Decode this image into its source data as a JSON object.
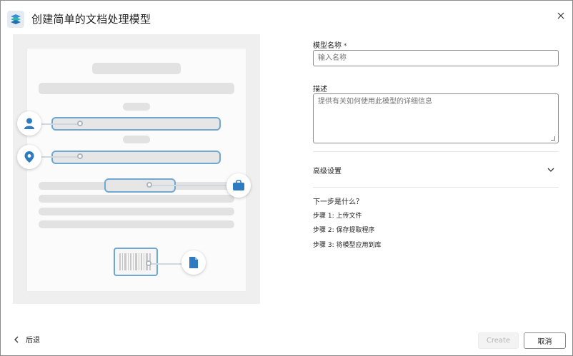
{
  "dialog": {
    "title": "创建简单的文档处理模型",
    "close_icon": "close-icon",
    "app_icon": "stack-layers-icon"
  },
  "form": {
    "name_label": "模型名称",
    "name_required_marker": "*",
    "name_placeholder": "输入名称",
    "description_label": "描述",
    "description_placeholder": "提供有关如何使用此模型的详细信息",
    "advanced_settings": "高级设置"
  },
  "next_steps": {
    "heading": "下一步是什么？",
    "steps": [
      "步骤 1: 上传文件",
      "步骤 2: 保存提取程序",
      "步骤 3: 将模型应用到库"
    ]
  },
  "footer": {
    "back_label": "后退",
    "create_label": "Create",
    "cancel_label": "取消"
  },
  "illustration_icons": [
    "person-icon",
    "location-pin-icon",
    "briefcase-icon",
    "barcode-icon",
    "document-icon"
  ],
  "colors": {
    "accent": "#2f7bbf",
    "field_border": "#6fa8d2",
    "disabled_text": "#b3b3b3"
  }
}
